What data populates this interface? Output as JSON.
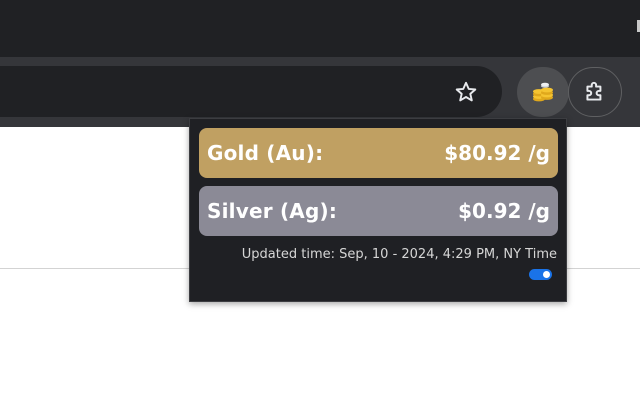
{
  "toolbar": {
    "bookmark_icon": "star-icon",
    "extension_icon": "gold-coins-icon",
    "extensions_menu_icon": "puzzle-icon"
  },
  "popup": {
    "rows": [
      {
        "label": "Gold (Au):",
        "price": "$80.92 /g",
        "color": "#c0a062"
      },
      {
        "label": "Silver (Ag):",
        "price": "$0.92 /g",
        "color": "#8b8a96"
      }
    ],
    "updated_text": "Updated time: Sep, 10 - 2024, 4:29 PM, NY Time",
    "toggle_on": true,
    "accent": "#1a73e8"
  }
}
